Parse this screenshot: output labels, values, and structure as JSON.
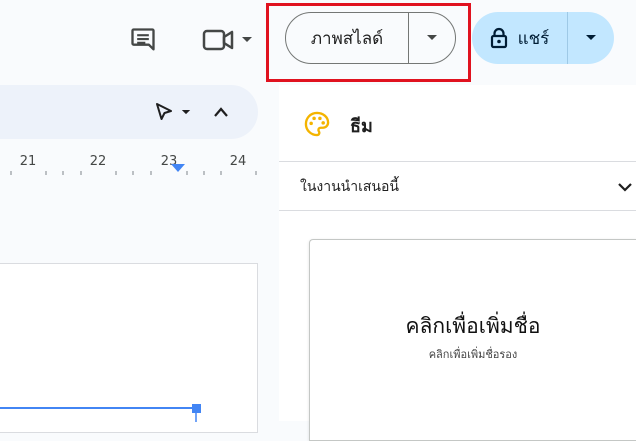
{
  "topbar": {
    "comments_icon": "comment-icon",
    "meet_icon": "video-camera-icon",
    "slideshow_label": "ภาพสไลด์",
    "share_label": "แชร์"
  },
  "toolbar": {
    "select_icon": "cursor-arrow-icon",
    "collapse_icon": "chevron-up-icon"
  },
  "ruler": {
    "labels": [
      "21",
      "22",
      "23",
      "24"
    ]
  },
  "theme_panel": {
    "icon": "palette-icon",
    "title": "ธีม",
    "section_label": "ในงานนำเสนอนี้",
    "thumbnail": {
      "title": "คลิกเพื่อเพิ่มชื่อ",
      "subtitle": "คลิกเพื่อเพิ่มชื่อรอง"
    }
  },
  "colors": {
    "highlight_box": "#e0121f",
    "share_bg": "#c2e7ff",
    "toolbar_bg": "#edf2fa",
    "accent_blue": "#4285f4",
    "palette_orange": "#f4b400"
  }
}
